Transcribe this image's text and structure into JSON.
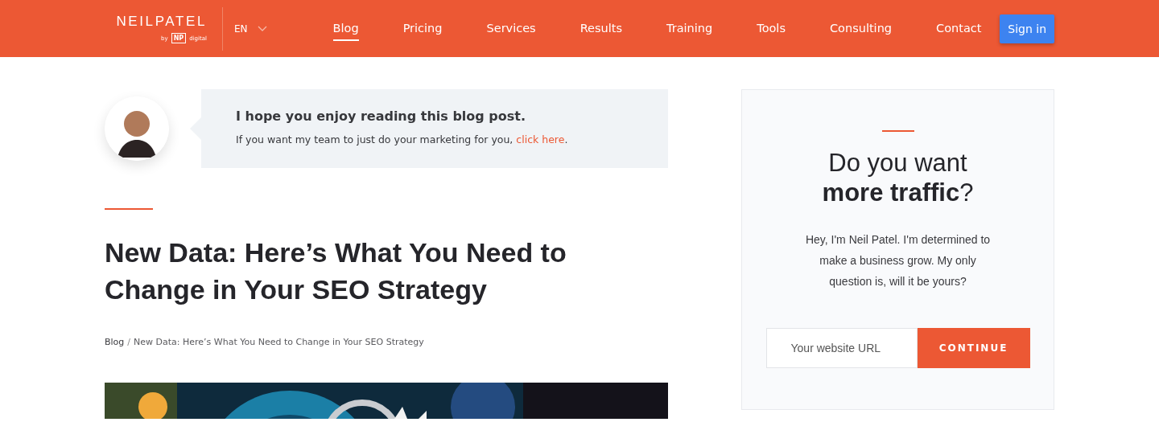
{
  "header": {
    "logo": {
      "name": "NEILPATEL",
      "by": "by",
      "badge": "NP",
      "suffix": "digital"
    },
    "language": "EN",
    "nav": [
      {
        "label": "Blog",
        "selected": true
      },
      {
        "label": "Pricing",
        "selected": false
      },
      {
        "label": "Services",
        "selected": false
      },
      {
        "label": "Results",
        "selected": false
      },
      {
        "label": "Training",
        "selected": false
      },
      {
        "label": "Tools",
        "selected": false
      },
      {
        "label": "Consulting",
        "selected": false
      },
      {
        "label": "Contact",
        "selected": false
      }
    ],
    "sign_in": "Sign in"
  },
  "callout": {
    "title": "I hope you enjoy reading this blog post.",
    "text": "If you want my team to just do your marketing for you, ",
    "link": "click here",
    "after": "."
  },
  "article": {
    "title": "New Data: Here’s What You Need to Change in Your SEO Strategy",
    "breadcrumb": [
      {
        "label": "Blog",
        "kind": "link"
      },
      {
        "label": "/",
        "kind": "separator"
      },
      {
        "label": "New Data: Here’s What You Need to Change in Your SEO Strategy",
        "kind": "current"
      }
    ]
  },
  "sidebar": {
    "headline": [
      "Do you want",
      "**more traffic**?"
    ],
    "text": "Hey, I'm Neil Patel. I'm determined to make a business grow. My only question is, will it be yours?",
    "url_placeholder": "Your website URL",
    "button": "CONTINUE"
  }
}
